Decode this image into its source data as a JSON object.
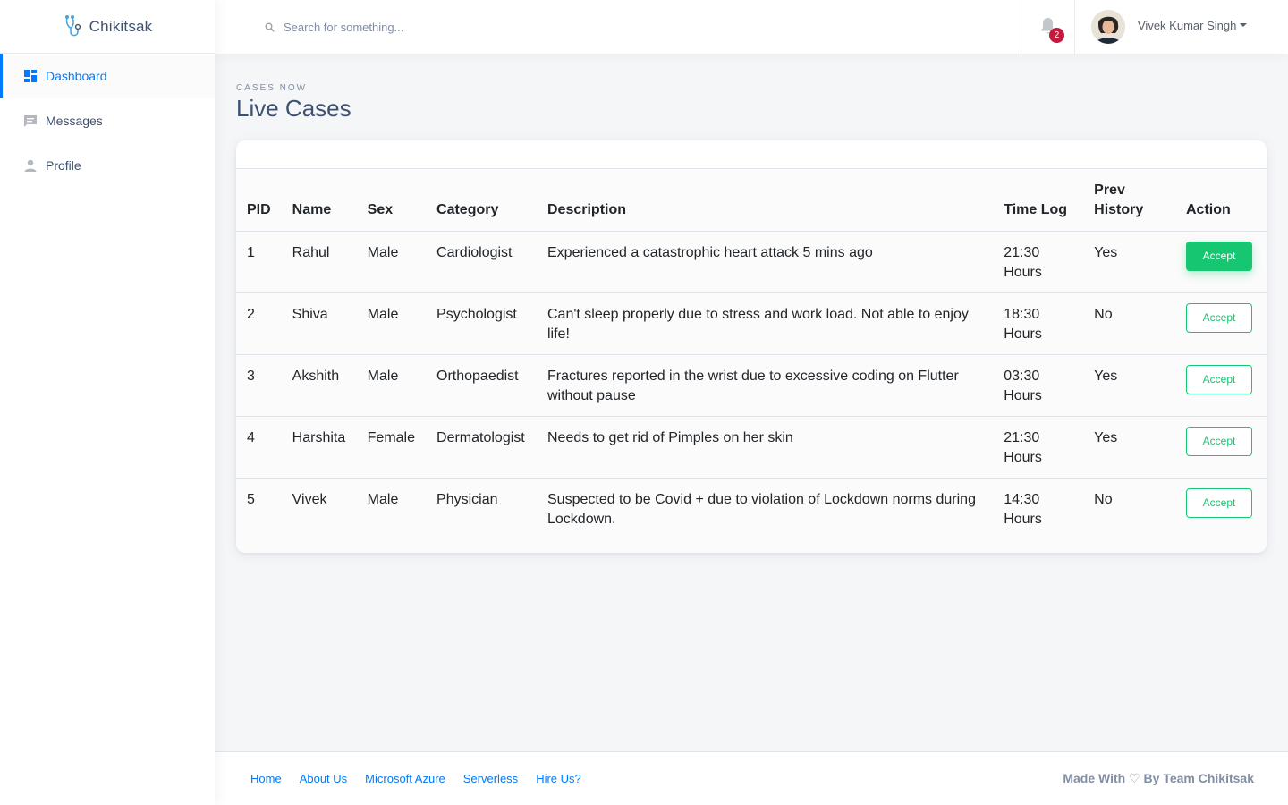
{
  "brand": {
    "name": "Chikitsak"
  },
  "sidebar": {
    "items": [
      {
        "label": "Dashboard",
        "icon": "dashboard-icon",
        "active": true
      },
      {
        "label": "Messages",
        "icon": "messages-icon",
        "active": false
      },
      {
        "label": "Profile",
        "icon": "person-icon",
        "active": false
      }
    ]
  },
  "topbar": {
    "search_placeholder": "Search for something...",
    "notification_count": "2",
    "user_name": "Vivek Kumar Singh"
  },
  "page": {
    "subtitle": "CASES NOW",
    "title": "Live Cases"
  },
  "table": {
    "headers": [
      "PID",
      "Name",
      "Sex",
      "Category",
      "Description",
      "Time Log",
      "Prev History",
      "Action"
    ],
    "rows": [
      {
        "pid": "1",
        "name": "Rahul",
        "sex": "Male",
        "category": "Cardiologist",
        "description": "Experienced a catastrophic heart attack 5 mins ago",
        "time_log": "21:30 Hours",
        "prev_history": "Yes",
        "action": "Accept"
      },
      {
        "pid": "2",
        "name": "Shiva",
        "sex": "Male",
        "category": "Psychologist",
        "description": "Can't sleep properly due to stress and work load. Not able to enjoy life!",
        "time_log": "18:30 Hours",
        "prev_history": "No",
        "action": "Accept"
      },
      {
        "pid": "3",
        "name": "Akshith",
        "sex": "Male",
        "category": "Orthopaedist",
        "description": "Fractures reported in the wrist due to excessive coding on Flutter without pause",
        "time_log": "03:30 Hours",
        "prev_history": "Yes",
        "action": "Accept"
      },
      {
        "pid": "4",
        "name": "Harshita",
        "sex": "Female",
        "category": "Dermatologist",
        "description": "Needs to get rid of Pimples on her skin",
        "time_log": "21:30 Hours",
        "prev_history": "Yes",
        "action": "Accept"
      },
      {
        "pid": "5",
        "name": "Vivek",
        "sex": "Male",
        "category": "Physician",
        "description": "Suspected to be Covid + due to violation of Lockdown norms during Lockdown.",
        "time_log": "14:30 Hours",
        "prev_history": "No",
        "action": "Accept"
      }
    ]
  },
  "footer": {
    "links": [
      "Home",
      "About Us",
      "Microsoft Azure",
      "Serverless",
      "Hire Us?"
    ],
    "copyright": "Made With ♡ By Team Chikitsak"
  },
  "colors": {
    "accent": "#007bff",
    "success": "#17c671",
    "danger": "#c4183c",
    "heading": "#3d5170"
  }
}
